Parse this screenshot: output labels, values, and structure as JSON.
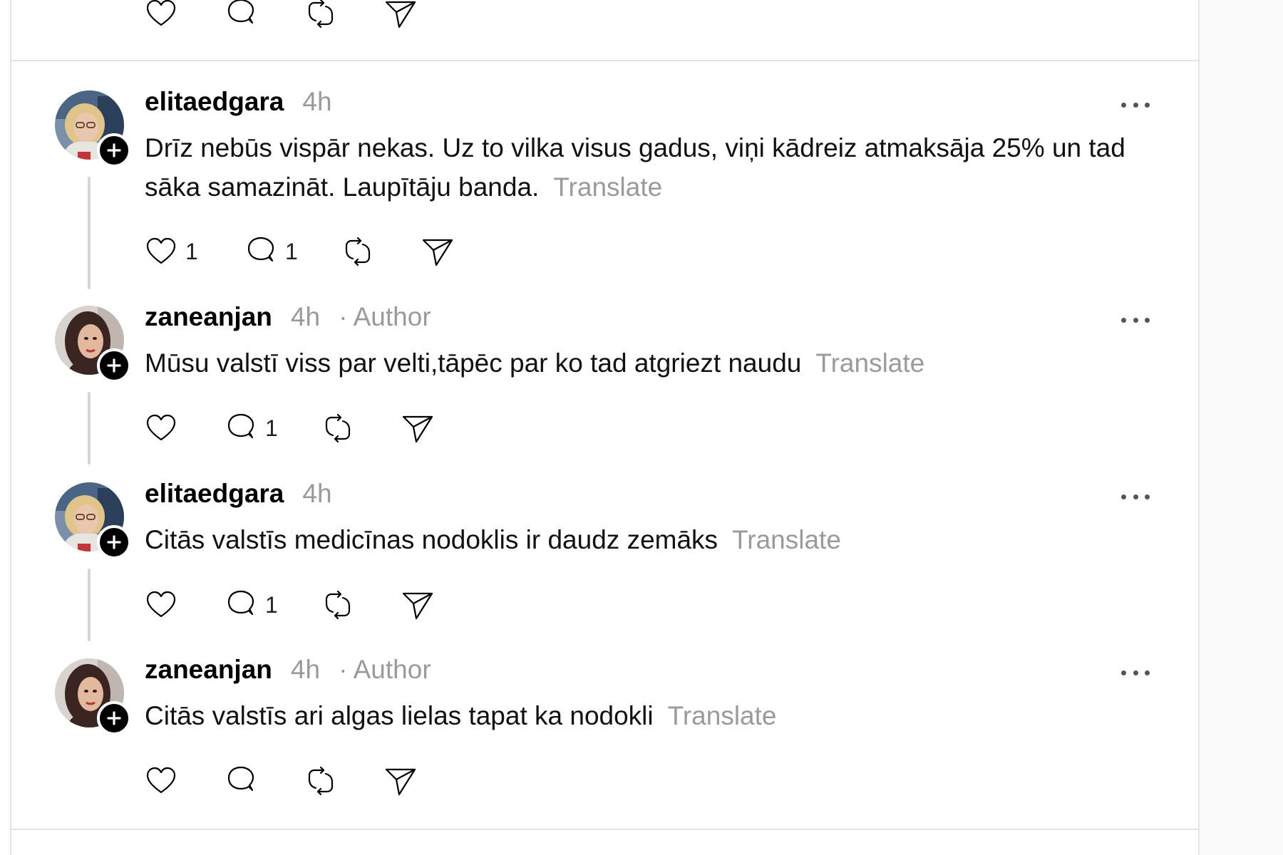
{
  "ui": {
    "translate_label": "Translate",
    "author_label": "· Author"
  },
  "top_actions": {
    "like_count": "",
    "reply_count": "",
    "repost_count": ""
  },
  "posts": [
    {
      "username": "elitaedgara",
      "time": "4h",
      "is_author": false,
      "text": "Drīz nebūs vispār nekas. Uz to vilka visus gadus, viņi kādreiz atmaksāja 25% un tad sāka samazināt. Laupītāju banda.",
      "likes": "1",
      "replies": "1",
      "avatar": "elderly-woman-glasses"
    },
    {
      "username": "zaneanjan",
      "time": "4h",
      "is_author": true,
      "text": "Mūsu valstī viss par velti,tāpēc par ko tad atgriezt naudu",
      "likes": "",
      "replies": "1",
      "avatar": "woman-dark-hair"
    },
    {
      "username": "elitaedgara",
      "time": "4h",
      "is_author": false,
      "text": "Citās valstīs medicīnas nodoklis ir daudz zemāks",
      "likes": "",
      "replies": "1",
      "avatar": "elderly-woman-glasses"
    },
    {
      "username": "zaneanjan",
      "time": "4h",
      "is_author": true,
      "text": "Citās valstīs ari algas lielas tapat ka nodokli",
      "likes": "",
      "replies": "",
      "avatar": "woman-dark-hair"
    }
  ],
  "colors": {
    "text": "#111111",
    "muted": "#9a9a9a",
    "border": "#e5e5e5",
    "thread_line": "#d6d6d6"
  }
}
